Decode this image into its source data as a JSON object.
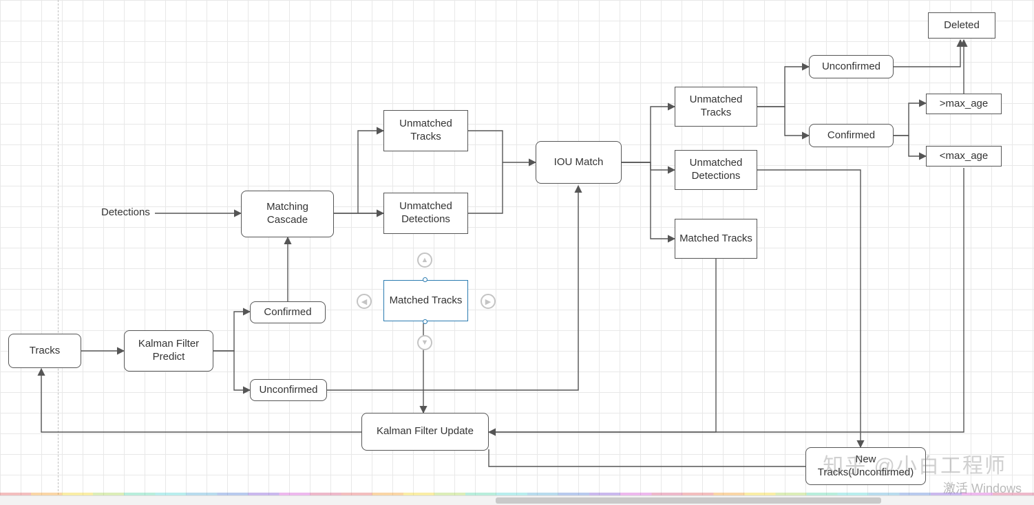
{
  "diagram": {
    "nodes": {
      "detections": "Detections",
      "tracks": "Tracks",
      "kalman_predict": "Kalman Filter Predict",
      "confirmed1": "Confirmed",
      "unconfirmed1": "Unconfirmed",
      "matching_cascade": "Matching Cascade",
      "unmatched_tracks1": "Unmatched Tracks",
      "unmatched_detections1": "Unmatched Detections",
      "matched_tracks1": "Matched Tracks",
      "iou_match": "IOU Match",
      "unmatched_tracks2": "Unmatched Tracks",
      "unmatched_detections2": "Unmatched Detections",
      "matched_tracks2": "Matched Tracks",
      "unconfirmed2": "Unconfirmed",
      "confirmed2": "Confirmed",
      "deleted": "Deleted",
      "gt_max_age": ">max_age",
      "lt_max_age": "<max_age",
      "kalman_update": "Kalman Filter Update",
      "new_tracks": "New Tracks(Unconfirmed)"
    }
  },
  "watermark": {
    "zhihu": "知乎 @小白工程师",
    "windows": "激活 Windows"
  }
}
